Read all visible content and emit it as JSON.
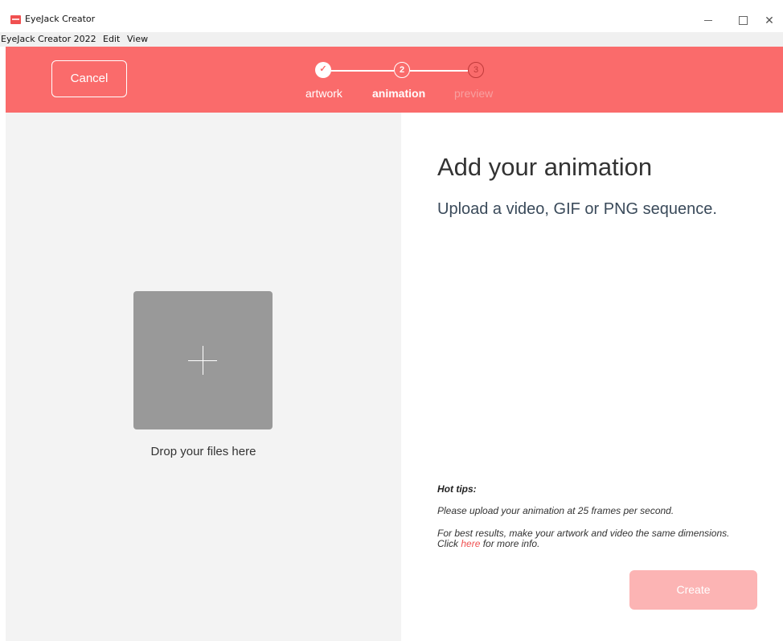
{
  "window": {
    "title": "EyeJack Creator",
    "minimize_glyph": "—",
    "maximize_glyph": "☐",
    "close_glyph": "✕"
  },
  "menu": {
    "items": [
      "EyeJack Creator 2022",
      "Edit",
      "View"
    ]
  },
  "header": {
    "cancel_label": "Cancel",
    "steps": [
      {
        "label": "artwork",
        "marker": "✓",
        "state": "done"
      },
      {
        "label": "animation",
        "marker": "2",
        "state": "active"
      },
      {
        "label": "preview",
        "marker": "3",
        "state": "pending"
      }
    ]
  },
  "dropzone": {
    "icon": "plus-icon",
    "text": "Drop your files here"
  },
  "content": {
    "heading": "Add your animation",
    "subheading": "Upload a video, GIF or PNG sequence.",
    "tips_title": "Hot tips:",
    "tip1": "Please upload your animation at 25 frames per second.",
    "tip2_line1": "For best results, make your artwork and video the same dimensions.",
    "tip2_click": "Click",
    "tip2_link": "here",
    "tip2_end": "for more info.",
    "create_label": "Create"
  },
  "colors": {
    "header_bg": "#fa6b6b",
    "link": "#f05050",
    "create_disabled": "#fcb4b4",
    "dropzone_bg": "#999999"
  }
}
